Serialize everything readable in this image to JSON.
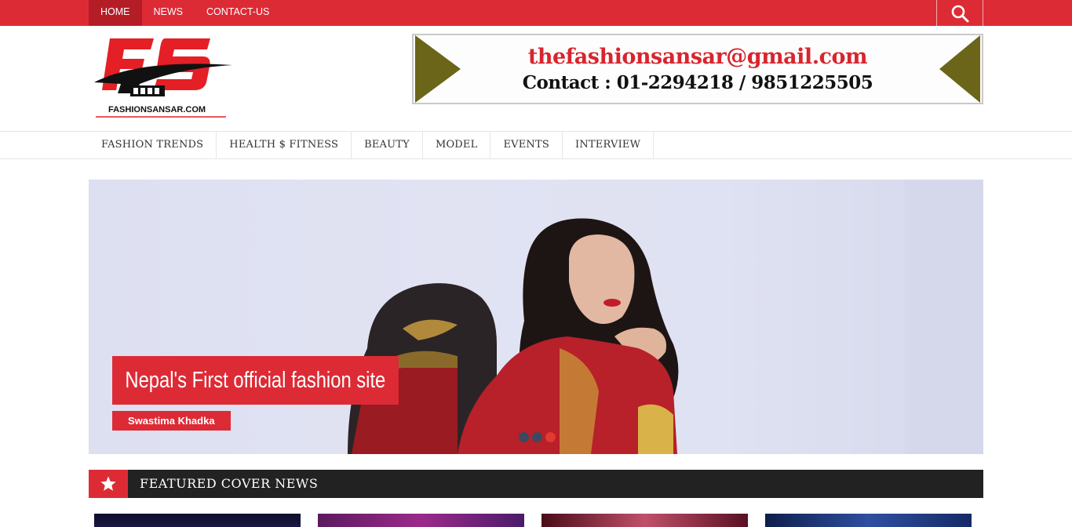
{
  "top_nav": {
    "items": [
      {
        "label": "HOME",
        "active": true
      },
      {
        "label": "NEWS",
        "active": false
      },
      {
        "label": "CONTACT-US",
        "active": false
      }
    ],
    "search_icon": "search-icon"
  },
  "logo": {
    "letters": "FS",
    "wordmark": "FASHIONSANSAR.COM"
  },
  "ad": {
    "email": "thefashionsansar@gmail.com",
    "contact": "Contact : 01-2294218 / 9851225505"
  },
  "main_nav": {
    "items": [
      "FASHION TRENDS",
      "HEALTH $ FITNESS",
      "BEAUTY",
      "MODEL",
      "EVENTS",
      "INTERVIEW"
    ]
  },
  "slider": {
    "title": "Nepal's First official fashion site",
    "tag": "Swastima Khadka",
    "dots": 3,
    "active_dot": 3
  },
  "featured": {
    "title": "FEATURED COVER NEWS",
    "icon": "star-icon"
  },
  "colors": {
    "brand_red": "#dd2b36",
    "dark_bar": "#222222",
    "ad_arrow": "#6b6519"
  }
}
